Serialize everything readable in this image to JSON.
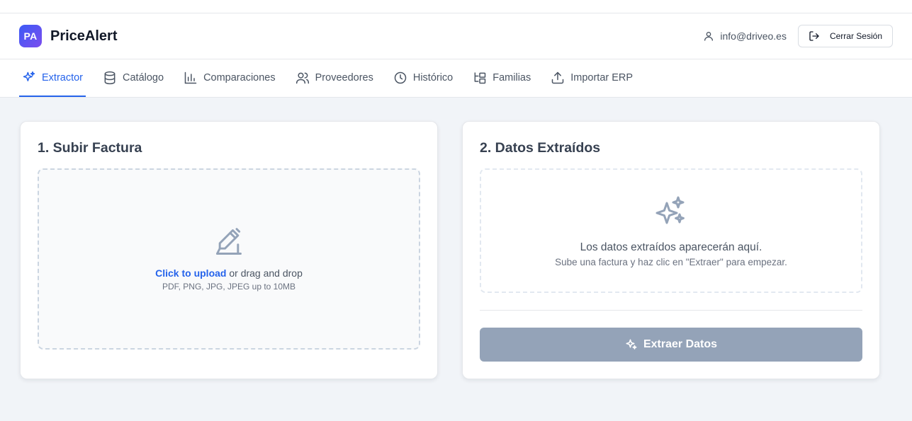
{
  "header": {
    "logo_text": "PA",
    "brand": "PriceAlert",
    "user_email": "info@driveo.es",
    "logout_label": "Cerrar Sesión"
  },
  "nav": {
    "items": [
      {
        "label": "Extractor",
        "icon": "sparkles-icon",
        "active": true
      },
      {
        "label": "Catálogo",
        "icon": "database-icon",
        "active": false
      },
      {
        "label": "Comparaciones",
        "icon": "bar-chart-icon",
        "active": false
      },
      {
        "label": "Proveedores",
        "icon": "users-icon",
        "active": false
      },
      {
        "label": "Histórico",
        "icon": "clock-icon",
        "active": false
      },
      {
        "label": "Familias",
        "icon": "folder-tree-icon",
        "active": false
      },
      {
        "label": "Importar ERP",
        "icon": "upload-icon",
        "active": false
      }
    ]
  },
  "upload": {
    "title": "1. Subir Factura",
    "link_text": "Click to upload",
    "rest_text": " or drag and drop",
    "hint": "PDF, PNG, JPG, JPEG up to 10MB",
    "icon": "file-signature-icon"
  },
  "extracted": {
    "title": "2. Datos Extraídos",
    "placeholder_title": "Los datos extraídos aparecerán aquí.",
    "placeholder_sub": "Sube una factura y haz clic en \"Extraer\" para empezar.",
    "button_label": "Extraer Datos",
    "icon": "sparkles-icon"
  },
  "colors": {
    "accent": "#2563eb",
    "logo_gradient_start": "#3b5bf6",
    "logo_gradient_end": "#7c4dee",
    "disabled_button": "#94a3b8",
    "page_background": "#f1f4f8"
  }
}
